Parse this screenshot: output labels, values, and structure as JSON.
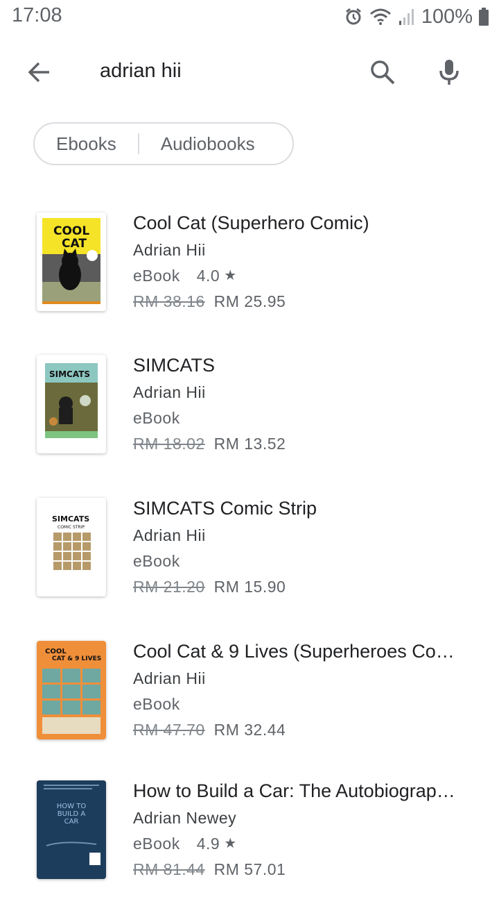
{
  "status_bar": {
    "time": "17:08",
    "battery": "100%",
    "icons": [
      "alarm-icon",
      "wifi-icon",
      "signal-icon",
      "battery-icon"
    ]
  },
  "search": {
    "query": "adrian hii",
    "back_icon": "arrow-back-icon",
    "search_icon": "search-icon",
    "mic_icon": "mic-icon"
  },
  "chips": {
    "ebooks": "Ebooks",
    "audiobooks": "Audiobooks"
  },
  "results": [
    {
      "title": "Cool Cat (Superhero Comic)",
      "author": "Adrian Hii",
      "format": "eBook",
      "rating": "4.0",
      "old_price": "RM 38.16",
      "price": "RM 25.95",
      "cover_lines": [
        "COOL",
        "CAT"
      ]
    },
    {
      "title": "SIMCATS",
      "author": "Adrian Hii",
      "format": "eBook",
      "rating": "",
      "old_price": "RM 18.02",
      "price": "RM 13.52",
      "cover_lines": [
        "SIMCATS"
      ]
    },
    {
      "title": "SIMCATS Comic Strip",
      "author": "Adrian Hii",
      "format": "eBook",
      "rating": "",
      "old_price": "RM 21.20",
      "price": "RM 15.90",
      "cover_lines": [
        "SIMCATS",
        "COMIC STRIP"
      ]
    },
    {
      "title": "Cool Cat & 9 Lives (Superheroes Co…",
      "author": "Adrian Hii",
      "format": "eBook",
      "rating": "",
      "old_price": "RM 47.70",
      "price": "RM 32.44",
      "cover_lines": [
        "COOL",
        "CAT & 9 LIVES"
      ]
    },
    {
      "title": "How to Build a Car: The Autobiograp…",
      "author": "Adrian Newey",
      "format": "eBook",
      "rating": "4.9",
      "old_price": "RM 81.44",
      "price": "RM 57.01",
      "cover_lines": [
        "HOW TO",
        "BUILD A",
        "CAR"
      ]
    }
  ],
  "colors": {
    "text_primary": "#202124",
    "text_secondary": "#5f6368",
    "divider": "#dadce0"
  }
}
